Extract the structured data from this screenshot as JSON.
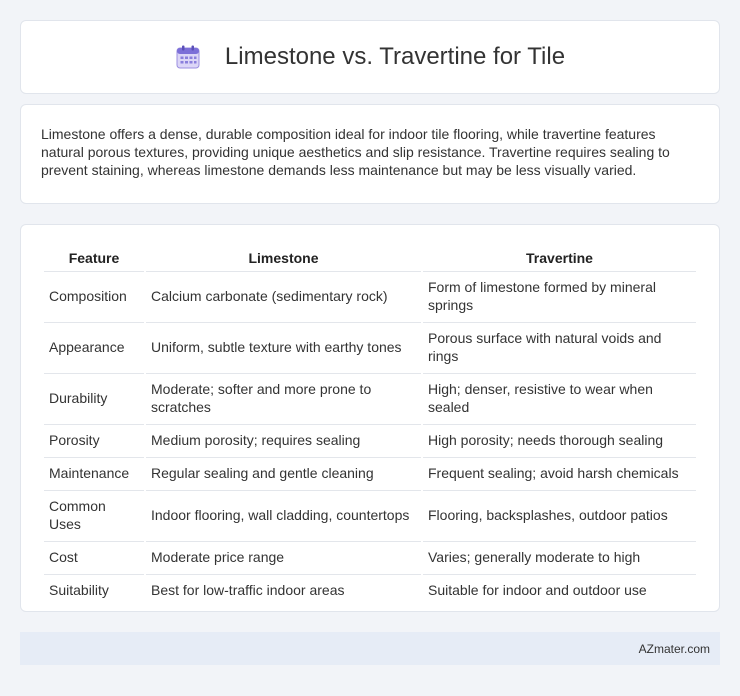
{
  "header": {
    "title": "Limestone vs. Travertine for Tile",
    "icon": "calendar-icon"
  },
  "summary": "Limestone offers a dense, durable composition ideal for indoor tile flooring, while travertine features natural porous textures, providing unique aesthetics and slip resistance. Travertine requires sealing to prevent staining, whereas limestone demands less maintenance but may be less visually varied.",
  "table": {
    "headers": [
      "Feature",
      "Limestone",
      "Travertine"
    ],
    "rows": [
      [
        "Composition",
        "Calcium carbonate (sedimentary rock)",
        "Form of limestone formed by mineral springs"
      ],
      [
        "Appearance",
        "Uniform, subtle texture with earthy tones",
        "Porous surface with natural voids and rings"
      ],
      [
        "Durability",
        "Moderate; softer and more prone to scratches",
        "High; denser, resistive to wear when sealed"
      ],
      [
        "Porosity",
        "Medium porosity; requires sealing",
        "High porosity; needs thorough sealing"
      ],
      [
        "Maintenance",
        "Regular sealing and gentle cleaning",
        "Frequent sealing; avoid harsh chemicals"
      ],
      [
        "Common Uses",
        "Indoor flooring, wall cladding, countertops",
        "Flooring, backsplashes, outdoor patios"
      ],
      [
        "Cost",
        "Moderate price range",
        "Varies; generally moderate to high"
      ],
      [
        "Suitability",
        "Best for low-traffic indoor areas",
        "Suitable for indoor and outdoor use"
      ]
    ]
  },
  "footer": {
    "brand": "AZmater.com"
  }
}
